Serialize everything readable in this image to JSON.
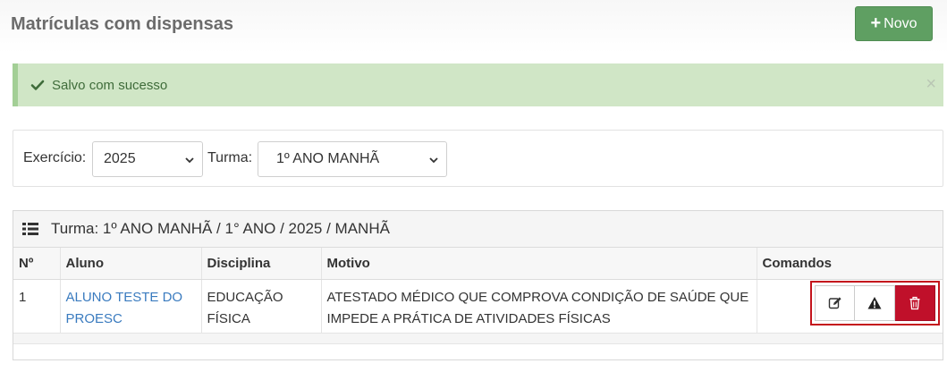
{
  "header": {
    "title": "Matrículas com dispensas",
    "new_button_label": "Novo"
  },
  "alert": {
    "message": "Salvo com sucesso",
    "close_glyph": "×",
    "color": "#d0e6c6"
  },
  "filters": {
    "exercicio_label": "Exercício:",
    "exercicio_value": "2025",
    "turma_label": "Turma:",
    "turma_value": "1º ANO MANHÃ"
  },
  "panel": {
    "heading": "Turma: 1º ANO MANHÃ / 1° ANO / 2025 / MANHÃ",
    "columns": [
      "Nº",
      "Aluno",
      "Disciplina",
      "Motivo",
      "Comandos"
    ],
    "rows": [
      {
        "numero": "1",
        "aluno": "ALUNO TESTE DO PROESC",
        "disciplina": "EDUCAÇÃO FÍSICA",
        "motivo": "ATESTADO MÉDICO QUE COMPROVA CONDIÇÃO DE SAÚDE QUE IMPEDE A PRÁTICA DE ATIVIDADES FÍSICAS"
      }
    ]
  },
  "commands": {
    "icons": [
      "edit-icon",
      "warning-icon",
      "trash-icon"
    ],
    "highlight_color": "#c4141c",
    "delete_color": "#c0102a"
  },
  "colors": {
    "primary_green": "#5f9f62",
    "link_blue": "#3a7bbf"
  }
}
